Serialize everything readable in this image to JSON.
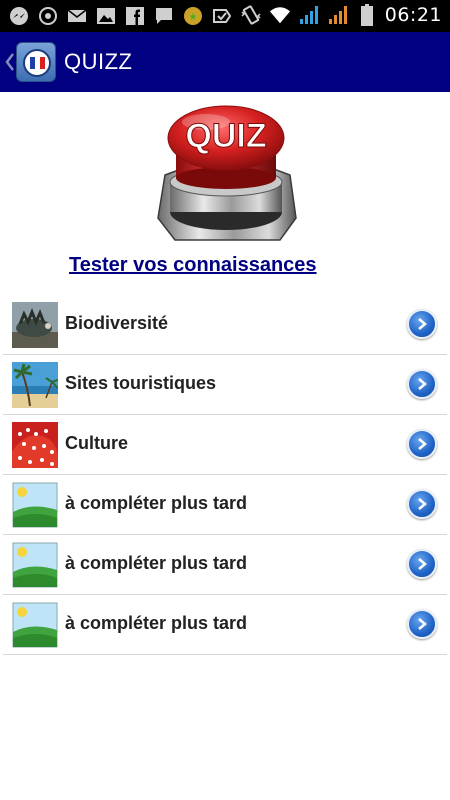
{
  "status_bar": {
    "time": "06:21",
    "icons": [
      "messenger-icon",
      "browser-icon",
      "mail-icon",
      "gallery-icon",
      "facebook-icon",
      "chat-icon",
      "badge-icon",
      "check-icon",
      "vibrate-icon",
      "wifi-icon",
      "signal-icon",
      "signal-icon-2",
      "battery-icon"
    ]
  },
  "app_bar": {
    "title": "QUIZZ"
  },
  "quiz_button": {
    "label": "QUIZ"
  },
  "test_link": {
    "label": "Tester vos connaissances"
  },
  "topics": [
    {
      "label": "Biodiversité",
      "thumb": "biodiversity"
    },
    {
      "label": "Sites touristiques",
      "thumb": "beach"
    },
    {
      "label": "Culture",
      "thumb": "culture"
    },
    {
      "label": "à compléter plus tard",
      "thumb": "placeholder"
    },
    {
      "label": "à compléter plus tard",
      "thumb": "placeholder"
    },
    {
      "label": "à compléter plus tard",
      "thumb": "placeholder"
    }
  ],
  "colors": {
    "app_bar": "#000080",
    "link": "#000080",
    "accent": "#1f63c7",
    "quiz_red": "#d62020"
  }
}
